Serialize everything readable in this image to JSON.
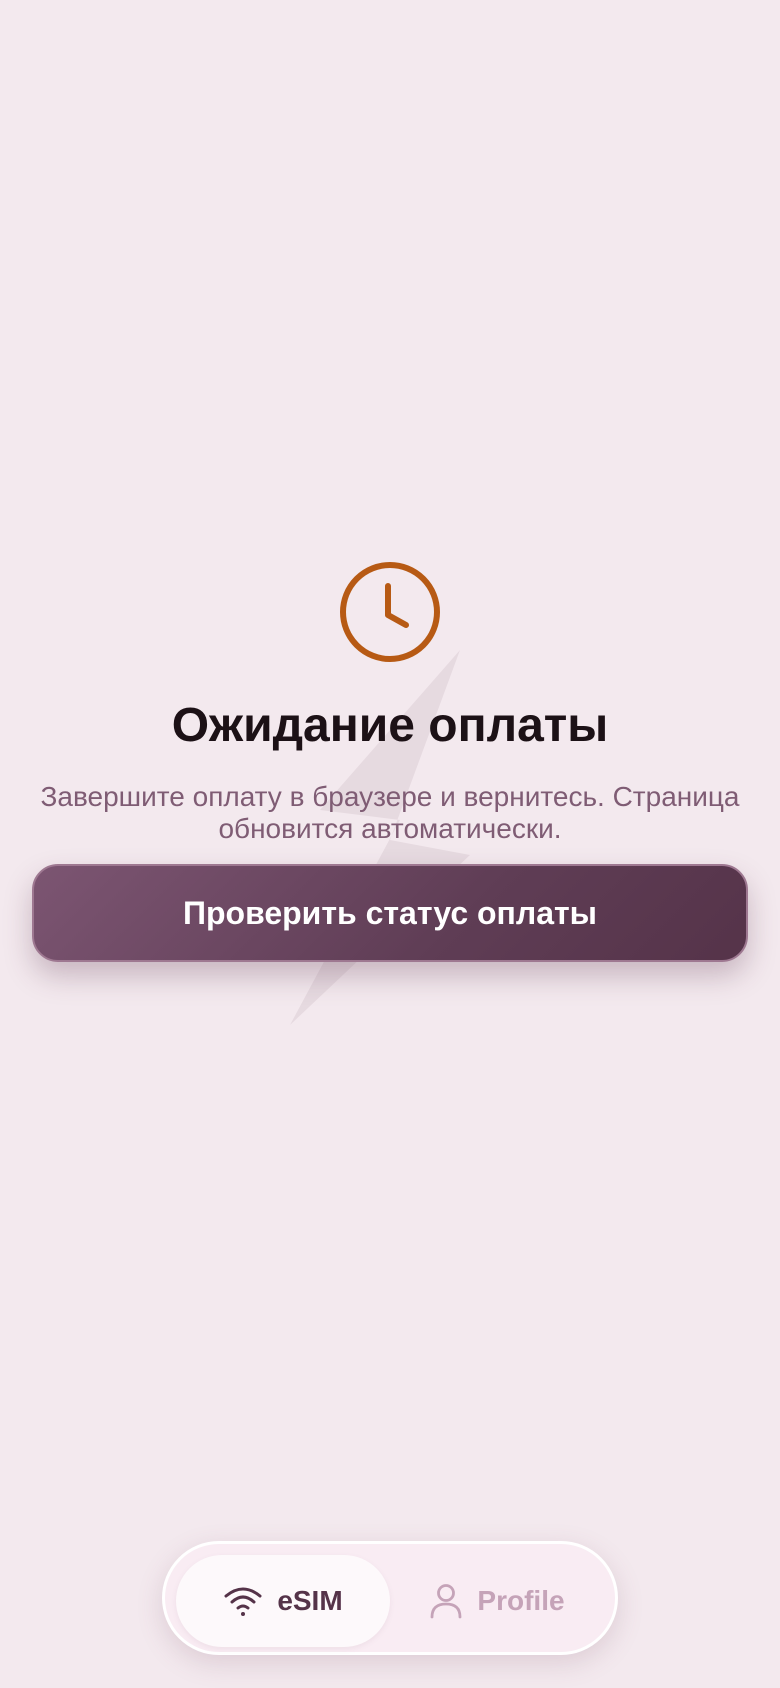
{
  "main": {
    "icon": "clock-icon",
    "title": "Ожидание оплаты",
    "subtitle": "Завершите оплату в браузере и вернитесь. Страница обновится автоматически.",
    "check_button_label": "Проверить статус оплаты"
  },
  "tabbar": {
    "tabs": [
      {
        "label": "eSIM",
        "icon": "wifi-icon",
        "active": true
      },
      {
        "label": "Profile",
        "icon": "person-icon",
        "active": false
      }
    ]
  },
  "colors": {
    "background": "#f3e9ee",
    "accent": "#b75a14",
    "primary": "#5f3d55",
    "title": "#1c1116",
    "subtitle": "#7f5c74",
    "tab_inactive": "#c5a3b8"
  }
}
